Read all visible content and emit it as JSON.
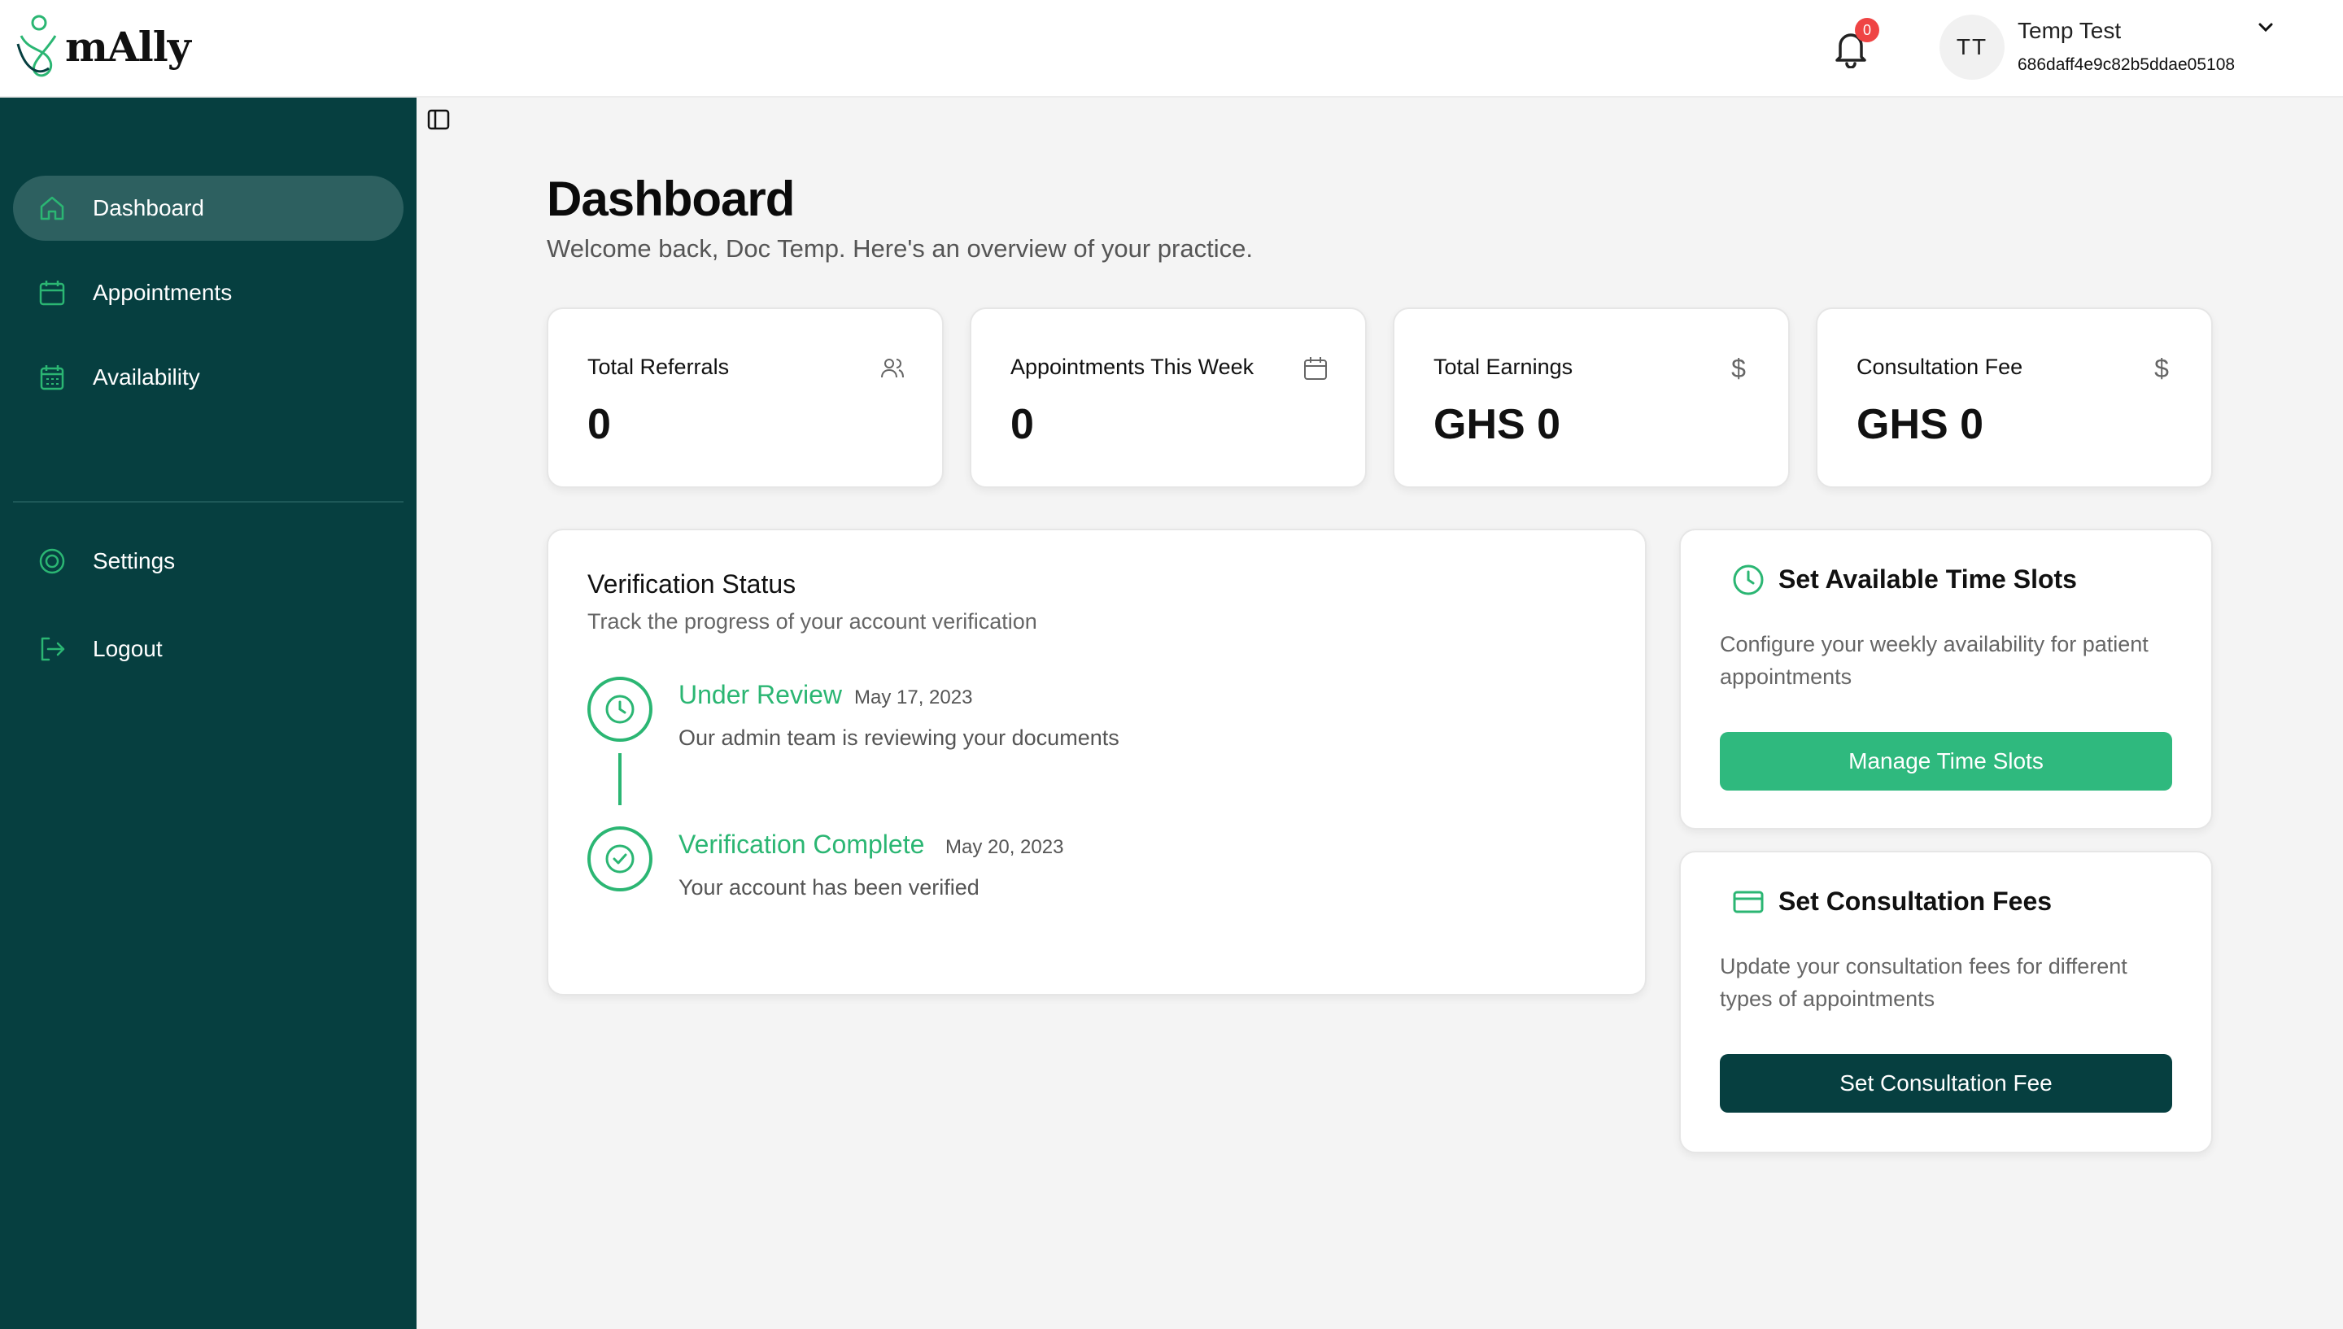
{
  "header": {
    "brand": "mAlly",
    "notification_count": "0",
    "user_initials": "TT",
    "user_name": "Temp Test",
    "user_id": "686daff4e9c82b5ddae05108"
  },
  "sidebar": {
    "items": [
      {
        "label": "Dashboard",
        "icon": "home-icon",
        "active": true
      },
      {
        "label": "Appointments",
        "icon": "calendar-icon",
        "active": false
      },
      {
        "label": "Availability",
        "icon": "calendar-grid-icon",
        "active": false
      },
      {
        "label": "Settings",
        "icon": "settings-icon",
        "active": false
      },
      {
        "label": "Logout",
        "icon": "logout-icon",
        "active": false
      }
    ]
  },
  "page": {
    "title": "Dashboard",
    "subtitle": "Welcome back, Doc Temp. Here's an overview of your practice."
  },
  "stats": [
    {
      "label": "Total Referrals",
      "value": "0",
      "icon": "users-icon"
    },
    {
      "label": "Appointments This Week",
      "value": "0",
      "icon": "calendar-icon"
    },
    {
      "label": "Total Earnings",
      "value": "GHS 0",
      "icon": "dollar-icon"
    },
    {
      "label": "Consultation Fee",
      "value": "GHS 0",
      "icon": "dollar-icon"
    }
  ],
  "verification": {
    "title": "Verification Status",
    "subtitle": "Track the progress of your account verification",
    "steps": [
      {
        "title": "Under Review",
        "date": "May 17, 2023",
        "description": "Our admin team is reviewing your documents"
      },
      {
        "title": "Verification Complete",
        "date": "May 20, 2023",
        "description": "Your account has been verified"
      }
    ]
  },
  "time_slots": {
    "title": "Set Available Time Slots",
    "description": "Configure your weekly availability for patient appointments",
    "button": "Manage Time Slots"
  },
  "fees": {
    "title": "Set Consultation Fees",
    "description": "Update your consultation fees for different types of appointments",
    "button": "Set Consultation Fee"
  },
  "colors": {
    "sidebar_bg": "#063f40",
    "accent_green": "#2bb673",
    "badge_red": "#ef4444"
  }
}
